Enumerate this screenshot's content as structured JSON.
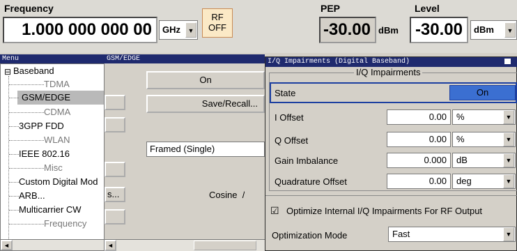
{
  "header": {
    "frequency_label": "Frequency",
    "frequency_value": "1.000 000 000 00",
    "frequency_unit": "GHz",
    "rf_button_line1": "RF",
    "rf_button_line2": "OFF",
    "pep_label": "PEP",
    "pep_value": "-30.00",
    "pep_unit": "dBm",
    "level_label": "Level",
    "level_value": "-30.00",
    "level_unit": "dBm"
  },
  "menu": {
    "title": "Menu",
    "root": "Baseband",
    "items": [
      "TDMA",
      "GSM/EDGE",
      "CDMA",
      "3GPP FDD",
      "WLAN",
      "IEEE 802.16",
      "Misc",
      "Custom Digital Mod",
      "ARB...",
      "Multicarrier CW",
      "Frequency"
    ]
  },
  "gsm_panel": {
    "title": "GSM/EDGE",
    "state_button": "On",
    "save_recall_button": "Save/Recall...",
    "mode_value": "Framed (Single)",
    "filter_text": "Cosine  /",
    "s_button": "s..."
  },
  "iq_panel": {
    "title": "I/Q Impairments (Digital Baseband)",
    "group_title": "I/Q Impairments",
    "state_label": "State",
    "state_value": "On",
    "rows": [
      {
        "label": "I Offset",
        "value": "0.00",
        "unit": "%"
      },
      {
        "label": "Q Offset",
        "value": "0.00",
        "unit": "%"
      },
      {
        "label": "Gain Imbalance",
        "value": "0.000",
        "unit": "dB"
      },
      {
        "label": "Quadrature Offset",
        "value": "0.00",
        "unit": "deg"
      }
    ],
    "optimize_label": "Optimize Internal I/Q Impairments For RF Output",
    "optimize_checked": "☑",
    "optimization_mode_label": "Optimization Mode",
    "optimization_mode_value": "Fast"
  },
  "icons": {
    "dropdown": "▼",
    "scroll_left": "◄",
    "tree_minus": "⊟"
  }
}
